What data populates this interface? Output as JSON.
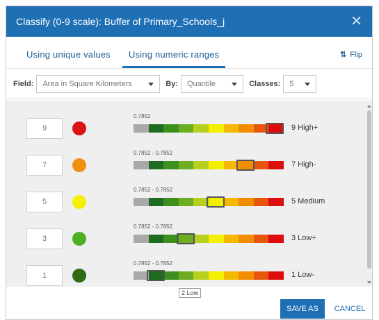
{
  "dialog": {
    "title": "Classify (0-9 scale): Buffer of Primary_Schools_j",
    "close_icon": "close-icon"
  },
  "tabs": [
    {
      "label": "Using unique values",
      "active": false
    },
    {
      "label": "Using numeric ranges",
      "active": true
    }
  ],
  "flip": {
    "icon": "swap-arrows-icon",
    "label": "Flip",
    "arrows": "⇅"
  },
  "fields": {
    "field_label": "Field:",
    "field_value": "Area in Square Kilometers",
    "by_label": "By:",
    "by_value": "Quantile",
    "classes_label": "Classes:",
    "classes_value": "5"
  },
  "ramp_colors": [
    "#a9a9a9",
    "#1f6b1f",
    "#3d8f1e",
    "#6cad22",
    "#b8cf1f",
    "#f4ee00",
    "#f5b800",
    "#f28c00",
    "#e8550d",
    "#dd0d0d"
  ],
  "rows": [
    {
      "value": "9",
      "dot_color": "#d81414",
      "range": "0.7852",
      "label": "9 High+",
      "marker_index": 9
    },
    {
      "value": "7",
      "dot_color": "#f08f10",
      "range": "0.7852 - 0.7852",
      "label": "7 High-",
      "marker_index": 7
    },
    {
      "value": "5",
      "dot_color": "#f6ef06",
      "range": "0.7852 - 0.7852",
      "label": "5 Medium",
      "marker_index": 5
    },
    {
      "value": "3",
      "dot_color": "#4caf24",
      "range": "0.7852 - 0.7852",
      "label": "3 Low+",
      "marker_index": 3
    },
    {
      "value": "1",
      "dot_color": "#2e6b14",
      "range": "0.7852 - 0.7852",
      "label": "1 Low-",
      "marker_index": 1
    }
  ],
  "tooltip": "2 Low",
  "buttons": {
    "save": "SAVE AS",
    "cancel": "CANCEL"
  }
}
